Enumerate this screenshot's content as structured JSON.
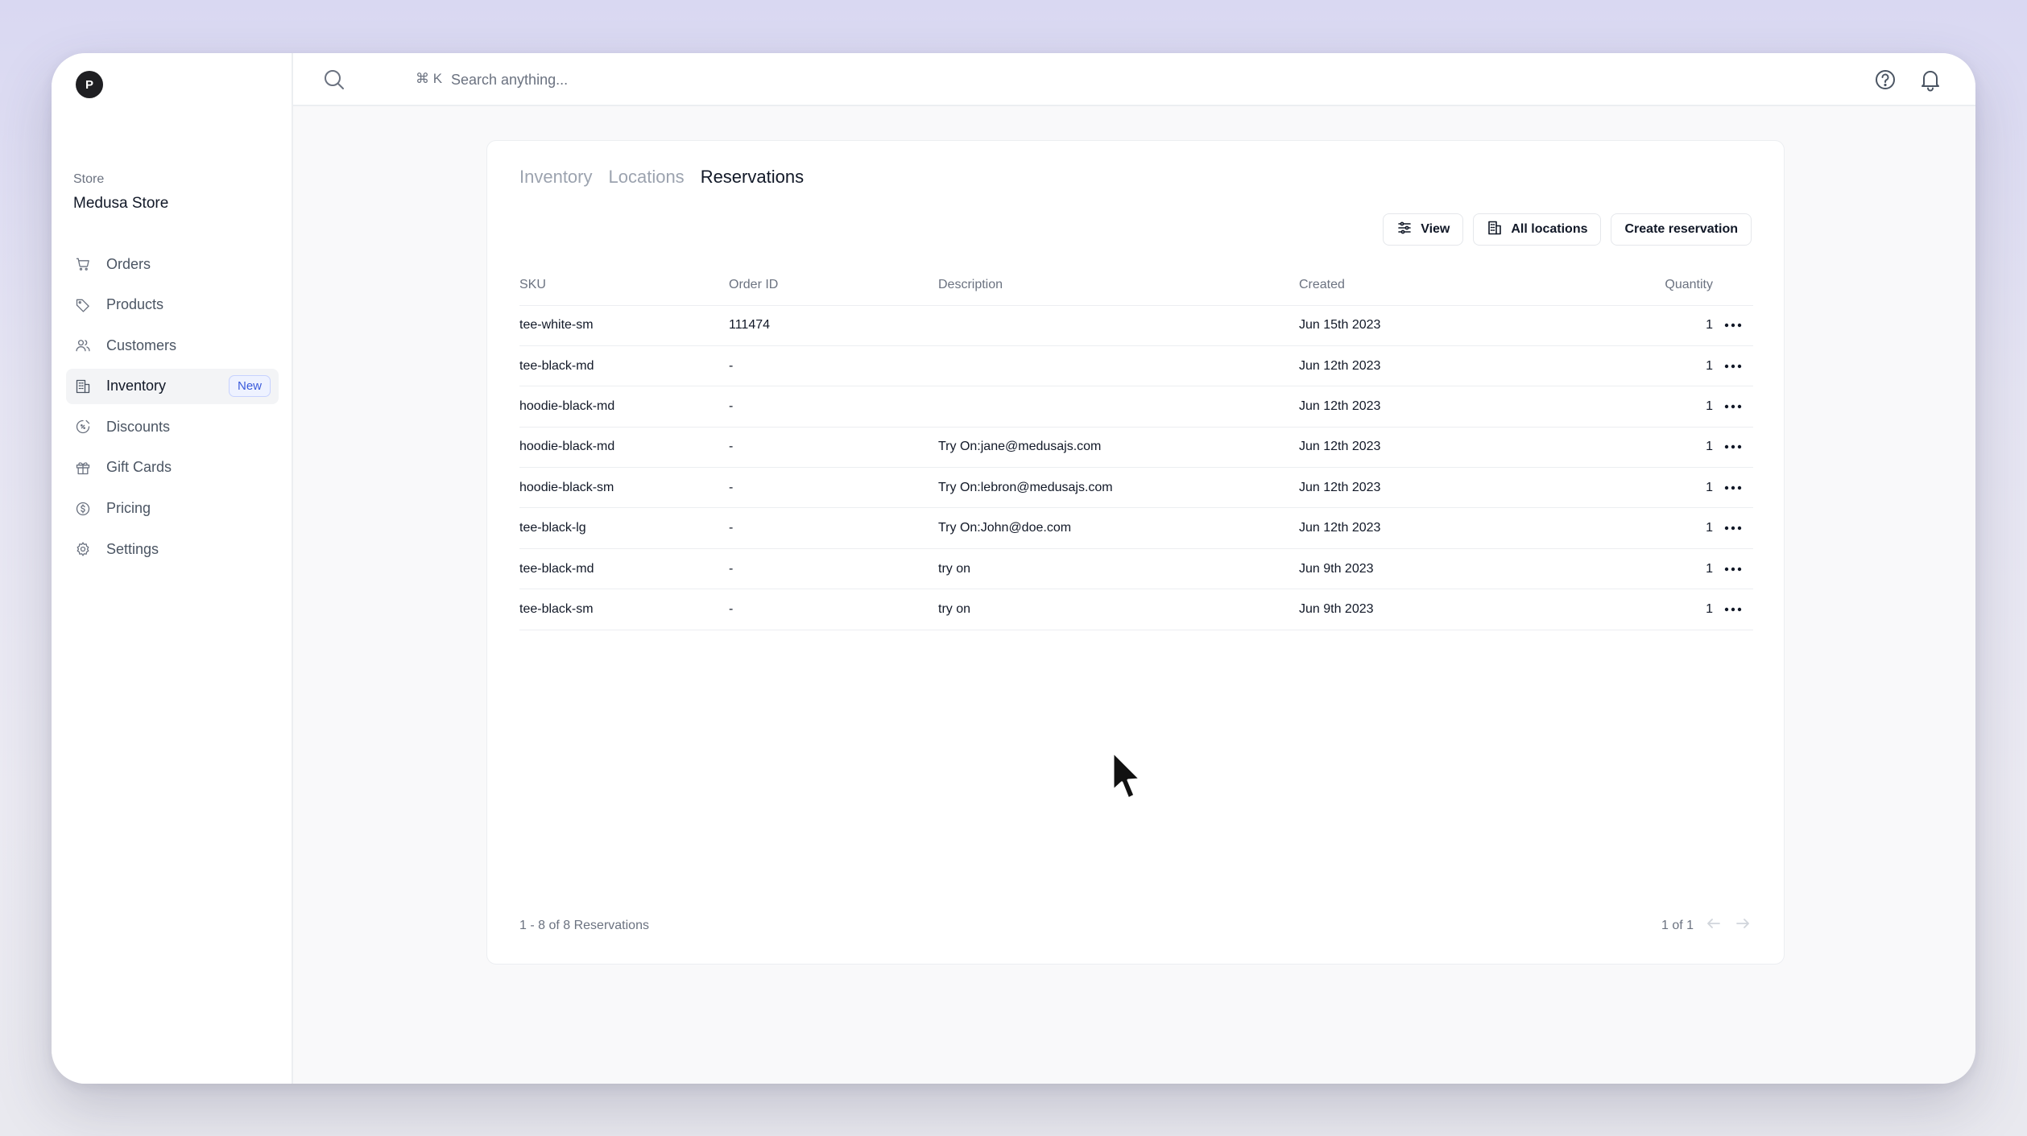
{
  "sidebar": {
    "avatar_letter": "P",
    "store_label": "Store",
    "store_name": "Medusa Store",
    "items": [
      {
        "label": "Orders",
        "icon": "cart-icon"
      },
      {
        "label": "Products",
        "icon": "tag-icon"
      },
      {
        "label": "Customers",
        "icon": "users-icon"
      },
      {
        "label": "Inventory",
        "icon": "building-icon",
        "badge": "New",
        "active": true
      },
      {
        "label": "Discounts",
        "icon": "discount-icon"
      },
      {
        "label": "Gift Cards",
        "icon": "gift-icon"
      },
      {
        "label": "Pricing",
        "icon": "coin-icon"
      },
      {
        "label": "Settings",
        "icon": "gear-icon"
      }
    ]
  },
  "topbar": {
    "shortcut": "⌘ K",
    "search_placeholder": "Search anything..."
  },
  "tabs": {
    "inventory": "Inventory",
    "locations": "Locations",
    "reservations": "Reservations",
    "active": "Reservations"
  },
  "toolbar": {
    "view_label": "View",
    "locations_label": "All locations",
    "create_label": "Create reservation"
  },
  "table": {
    "columns": {
      "sku": "SKU",
      "order_id": "Order ID",
      "description": "Description",
      "created": "Created",
      "quantity": "Quantity"
    },
    "rows": [
      {
        "sku": "tee-white-sm",
        "order_id": "111474",
        "description": "",
        "created": "Jun 15th 2023",
        "quantity": "1"
      },
      {
        "sku": "tee-black-md",
        "order_id": "-",
        "description": "",
        "created": "Jun 12th 2023",
        "quantity": "1"
      },
      {
        "sku": "hoodie-black-md",
        "order_id": "-",
        "description": "",
        "created": "Jun 12th 2023",
        "quantity": "1"
      },
      {
        "sku": "hoodie-black-md",
        "order_id": "-",
        "description": "Try On:jane@medusajs.com",
        "created": "Jun 12th 2023",
        "quantity": "1"
      },
      {
        "sku": "hoodie-black-sm",
        "order_id": "-",
        "description": "Try On:lebron@medusajs.com",
        "created": "Jun 12th 2023",
        "quantity": "1"
      },
      {
        "sku": "tee-black-lg",
        "order_id": "-",
        "description": "Try On:John@doe.com",
        "created": "Jun 12th 2023",
        "quantity": "1"
      },
      {
        "sku": "tee-black-md",
        "order_id": "-",
        "description": "try on",
        "created": "Jun 9th 2023",
        "quantity": "1"
      },
      {
        "sku": "tee-black-sm",
        "order_id": "-",
        "description": "try on",
        "created": "Jun 9th 2023",
        "quantity": "1"
      }
    ]
  },
  "footer": {
    "count": "1 - 8 of 8 Reservations",
    "page": "1 of 1"
  },
  "colors": {
    "accent_badge": "#3b5bdb",
    "text_primary": "#111827",
    "text_muted": "#6b7280"
  }
}
